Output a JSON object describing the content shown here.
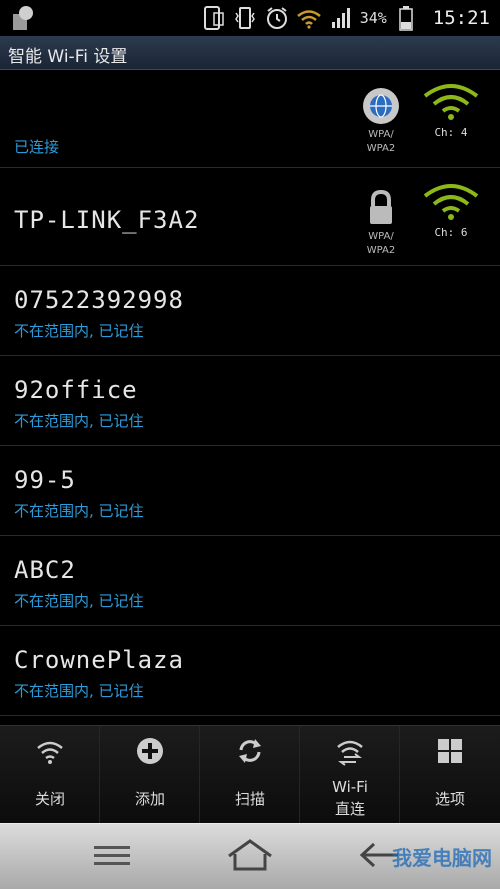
{
  "status_bar": {
    "battery_percent": "34%",
    "time": "15:21",
    "icons": [
      "app-notification-icon",
      "phone-icon",
      "vibrate-icon",
      "alarm-icon",
      "wifi-icon",
      "cell-signal-icon",
      "battery-icon"
    ]
  },
  "title": "智能 Wi-Fi 设置",
  "networks": [
    {
      "name": "",
      "status": "已连接",
      "security": "WPA/\nWPA2",
      "security_icon": "wps-globe-icon",
      "channel": "Ch: 4",
      "signal_icon": "wifi-signal-icon"
    },
    {
      "name": "TP-LINK_F3A2",
      "status": "",
      "security": "WPA/\nWPA2",
      "security_icon": "lock-icon",
      "channel": "Ch: 6",
      "signal_icon": "wifi-signal-icon"
    },
    {
      "name": "07522392998",
      "status": "不在范围内, 已记住"
    },
    {
      "name": "92office",
      "status": "不在范围内, 已记住"
    },
    {
      "name": "99-5",
      "status": "不在范围内, 已记住"
    },
    {
      "name": "ABC2",
      "status": "不在范围内, 已记住"
    },
    {
      "name": "CrownePlaza",
      "status": "不在范围内, 已记住"
    }
  ],
  "actions": [
    {
      "label": "关闭",
      "icon": "wifi-off-icon"
    },
    {
      "label": "添加",
      "icon": "add-icon"
    },
    {
      "label": "扫描",
      "icon": "refresh-icon"
    },
    {
      "label": "Wi-Fi",
      "label2": "直连",
      "icon": "wifi-direct-icon"
    },
    {
      "label": "选项",
      "icon": "grid-icon"
    }
  ],
  "nav": {
    "watermark": "我爱电脑网"
  },
  "colors": {
    "accent_blue": "#2d9bd9",
    "signal_green": "#8cb81a"
  }
}
